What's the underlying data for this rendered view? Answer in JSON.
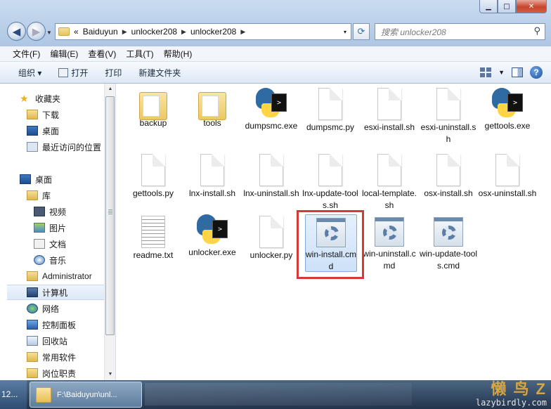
{
  "window": {
    "buttons": {
      "minimize": "▁",
      "maximize": "□",
      "close": "✕"
    }
  },
  "address": {
    "prefix": "«",
    "crumbs": [
      "Baiduyun",
      "unlocker208",
      "unlocker208"
    ],
    "dropdown": "▾"
  },
  "search": {
    "placeholder": "搜索 unlocker208"
  },
  "menu": [
    "文件(F)",
    "编辑(E)",
    "查看(V)",
    "工具(T)",
    "帮助(H)"
  ],
  "toolbar": {
    "organize": "组织 ▾",
    "open": "打开",
    "print": "打印",
    "new_folder": "新建文件夹"
  },
  "sidebar": {
    "favorites": {
      "title": "收藏夹",
      "items": [
        "下载",
        "桌面",
        "最近访问的位置"
      ]
    },
    "desktop": {
      "title": "桌面",
      "library": "库",
      "library_items": [
        "视频",
        "图片",
        "文档",
        "音乐"
      ],
      "others": [
        "Administrator",
        "计算机",
        "网络",
        "控制面板",
        "回收站",
        "常用软件",
        "岗位职责"
      ]
    }
  },
  "files": [
    {
      "name": "backup",
      "type": "folder"
    },
    {
      "name": "tools",
      "type": "folder"
    },
    {
      "name": "dumpsmc.exe",
      "type": "python-exe"
    },
    {
      "name": "dumpsmc.py",
      "type": "page"
    },
    {
      "name": "esxi-install.sh",
      "type": "page"
    },
    {
      "name": "esxi-uninstall.sh",
      "type": "page"
    },
    {
      "name": "gettools.exe",
      "type": "python-exe"
    },
    {
      "name": "gettools.py",
      "type": "page"
    },
    {
      "name": "lnx-install.sh",
      "type": "page"
    },
    {
      "name": "lnx-uninstall.sh",
      "type": "page"
    },
    {
      "name": "lnx-update-tools.sh",
      "type": "page"
    },
    {
      "name": "local-template.sh",
      "type": "page"
    },
    {
      "name": "osx-install.sh",
      "type": "page"
    },
    {
      "name": "osx-uninstall.sh",
      "type": "page"
    },
    {
      "name": "readme.txt",
      "type": "text"
    },
    {
      "name": "unlocker.exe",
      "type": "python-exe"
    },
    {
      "name": "unlocker.py",
      "type": "page"
    },
    {
      "name": "win-install.cmd",
      "type": "cmd",
      "selected": true
    },
    {
      "name": "win-uninstall.cmd",
      "type": "cmd"
    },
    {
      "name": "win-update-tools.cmd",
      "type": "cmd"
    }
  ],
  "taskbar": {
    "start_text": "12...",
    "task_label": "F:\\Baiduyun\\unl..."
  },
  "watermark": {
    "big": "懒 鸟 Z",
    "small": "lazybirdly.com"
  }
}
